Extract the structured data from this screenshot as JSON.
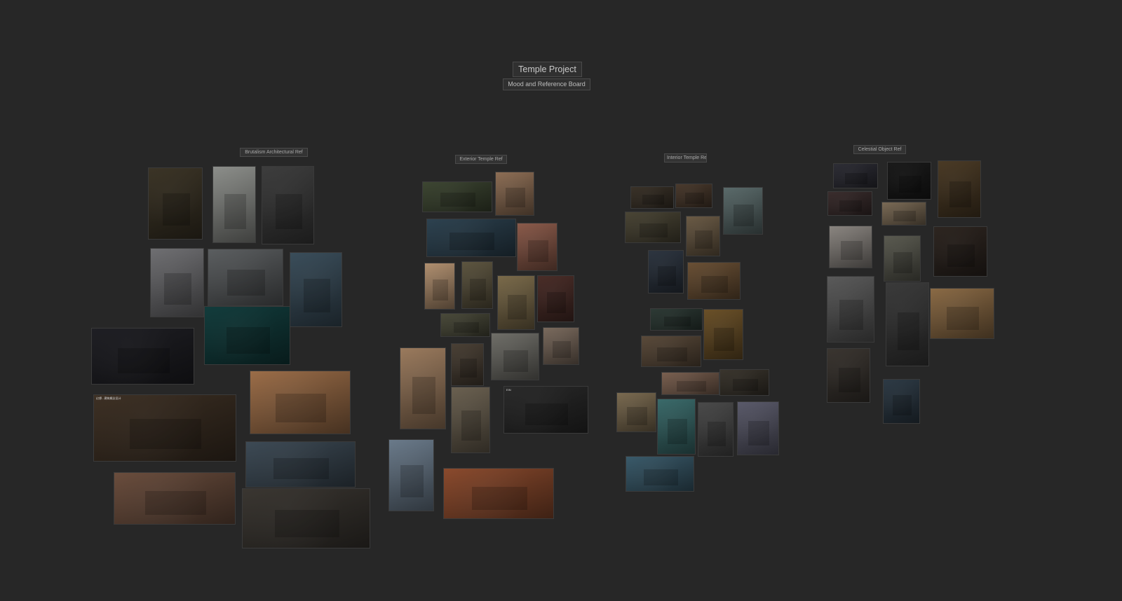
{
  "board": {
    "title": "Temple Project",
    "subtitle": "Mood and Reference Board"
  },
  "groups": [
    {
      "label": "Brutalism Architectural Ref",
      "images": [
        {
          "tone": "#3b3426"
        },
        {
          "tone": "#8c8e8a"
        },
        {
          "tone": "#3d3d3d"
        },
        {
          "tone": "#6f6f72"
        },
        {
          "tone": "#5b5e60"
        },
        {
          "tone": "#3a4d5a"
        },
        {
          "tone": "#1f1f24"
        },
        {
          "tone": "#123c3c"
        },
        {
          "tone": "#9b6d48"
        },
        {
          "tone": "#3d3024",
          "caption": "幻想 - 建筑概念设计"
        },
        {
          "tone": "#3d4a55"
        },
        {
          "tone": "#6a4d3d"
        },
        {
          "tone": "#3a3631"
        }
      ]
    },
    {
      "label": "Exterior Temple Ref",
      "images": [
        {
          "tone": "#3d4632"
        },
        {
          "tone": "#8d6e55"
        },
        {
          "tone": "#2d4250"
        },
        {
          "tone": "#8a5a4a"
        },
        {
          "tone": "#b08f6f"
        },
        {
          "tone": "#5d5540"
        },
        {
          "tone": "#7a6a4a"
        },
        {
          "tone": "#4a2d28"
        },
        {
          "tone": "#4a4a3a"
        },
        {
          "tone": "#6f6e68"
        },
        {
          "tone": "#7a6a5d"
        },
        {
          "tone": "#9a7a5d"
        },
        {
          "tone": "#4a4035"
        },
        {
          "tone": "#6a6050"
        },
        {
          "tone": "#2a2a2a",
          "caption": "EIN"
        },
        {
          "tone": "#6a7a8a"
        },
        {
          "tone": "#8a4a2d"
        }
      ]
    },
    {
      "label": "Interior Temple Ref",
      "images": [
        {
          "tone": "#3a3228"
        },
        {
          "tone": "#4a3a2d"
        },
        {
          "tone": "#5a6a6a"
        },
        {
          "tone": "#4a4535"
        },
        {
          "tone": "#6a5a45"
        },
        {
          "tone": "#2d3540"
        },
        {
          "tone": "#6a5035"
        },
        {
          "tone": "#2d3a35"
        },
        {
          "tone": "#6a5028"
        },
        {
          "tone": "#5a4a3a"
        },
        {
          "tone": "#7a6050"
        },
        {
          "tone": "#3a352d"
        },
        {
          "tone": "#7a6a50"
        },
        {
          "tone": "#3a6a6a"
        },
        {
          "tone": "#4a4a4a"
        },
        {
          "tone": "#5a5a6a"
        },
        {
          "tone": "#3a5a6a"
        }
      ]
    },
    {
      "label": "Celestial Object Ref",
      "images": [
        {
          "tone": "#2d2d35"
        },
        {
          "tone": "#1a1a1a"
        },
        {
          "tone": "#4a3a25"
        },
        {
          "tone": "#3a2d2d"
        },
        {
          "tone": "#7a6a55"
        },
        {
          "tone": "#8a8580"
        },
        {
          "tone": "#5a5a50"
        },
        {
          "tone": "#2d2520"
        },
        {
          "tone": "#5a5a5a"
        },
        {
          "tone": "#3a3a3a"
        },
        {
          "tone": "#8a6a45"
        },
        {
          "tone": "#3a3530"
        },
        {
          "tone": "#2d3a45"
        }
      ]
    }
  ]
}
